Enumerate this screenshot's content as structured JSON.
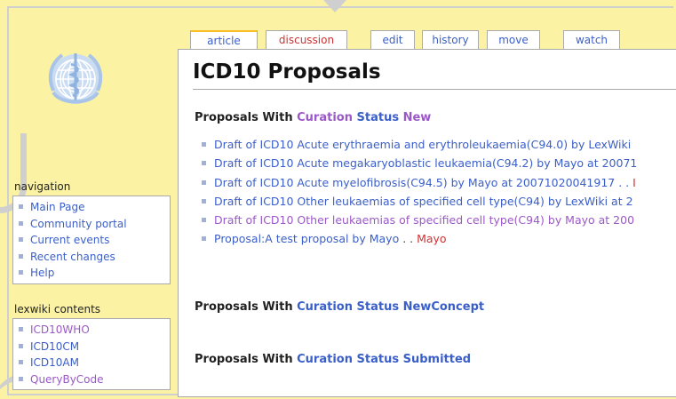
{
  "tabs": [
    {
      "label": "article",
      "state": "selected"
    },
    {
      "label": "discussion",
      "state": "new"
    },
    {
      "label": "edit",
      "state": "normal"
    },
    {
      "label": "history",
      "state": "normal"
    },
    {
      "label": "move",
      "state": "normal"
    },
    {
      "label": "watch",
      "state": "normal"
    }
  ],
  "page": {
    "title": "ICD10 Proposals"
  },
  "sections": [
    {
      "prefix": "Proposals With ",
      "word1": "Curation",
      "word2": "Status",
      "word3": "New"
    },
    {
      "prefix": "Proposals With ",
      "word1": "Curation",
      "word2": "Status",
      "word3": "NewConcept"
    },
    {
      "prefix": "Proposals With ",
      "word1": "Curation",
      "word2": "Status",
      "word3": "Submitted"
    }
  ],
  "proposals": [
    {
      "text": "Draft of ICD10 Acute erythraemia and erythroleukaemia(C94.0) by LexWiki",
      "trail": "",
      "user": "",
      "visited": false
    },
    {
      "text": "Draft of ICD10 Acute megakaryoblastic leukaemia(C94.2) by Mayo at 20071",
      "trail": "",
      "user": "",
      "visited": false
    },
    {
      "text": "Draft of ICD10 Acute myelofibrosis(C94.5) by Mayo at 20071020041917 . .",
      "trail": "",
      "user": "I",
      "visited": false
    },
    {
      "text": "Draft of ICD10 Other leukaemias of specified cell type(C94) by LexWiki at 2",
      "trail": "",
      "user": "",
      "visited": false
    },
    {
      "text": "Draft of ICD10 Other leukaemias of specified cell type(C94) by Mayo at 200",
      "trail": "",
      "user": "",
      "visited": true
    },
    {
      "text": "Proposal:A test proposal by Mayo",
      "trail": " . . ",
      "user": "Mayo",
      "visited": false
    }
  ],
  "sidebar": {
    "navigation": {
      "heading": "navigation",
      "items": [
        "Main Page",
        "Community portal",
        "Current events",
        "Recent changes",
        "Help"
      ]
    },
    "lexwiki": {
      "heading": "lexwiki contents",
      "items": [
        "ICD10WHO",
        "ICD10CM",
        "ICD10AM",
        "QueryByCode"
      ]
    }
  },
  "colors": {
    "background": "#fbf3a3",
    "link": "#3b5fc8",
    "visited": "#9b59c8",
    "new_link": "#cc3333",
    "tab_accent": "#fabd23"
  },
  "icons": {
    "logo": "who-emblem-logo"
  }
}
